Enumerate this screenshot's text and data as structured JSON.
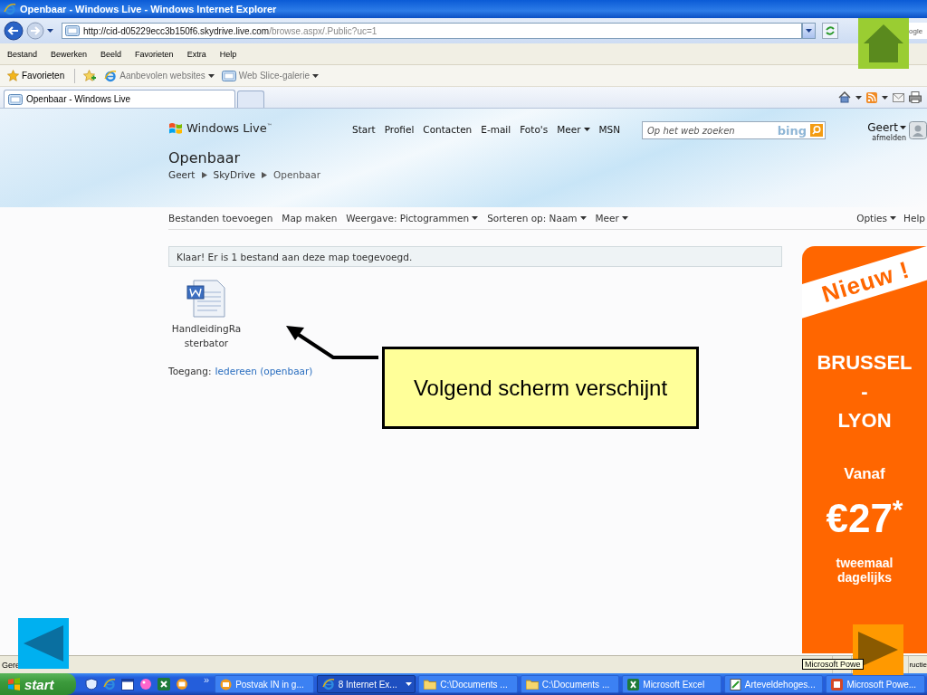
{
  "window": {
    "title": "Openbaar - Windows Live - Windows Internet Explorer"
  },
  "address_bar": {
    "url_host": "http://cid-d05229ecc3b150f6.skydrive.live.com",
    "url_path": "/browse.aspx/.Public?uc=1",
    "search_placeholder": "ogle"
  },
  "menu": [
    "Bestand",
    "Bewerken",
    "Beeld",
    "Favorieten",
    "Extra",
    "Help"
  ],
  "favorites_bar": {
    "favorites": "Favorieten",
    "links": [
      {
        "label": "Aanbevolen websites",
        "dropdown": true
      },
      {
        "label": "Web Slice-galerie",
        "dropdown": true
      }
    ]
  },
  "tabs": [
    {
      "label": "Openbaar - Windows Live",
      "selected": true
    }
  ],
  "page": {
    "logo": "Windows Live$^{™}$",
    "nav": [
      {
        "label": "Start",
        "dropdown": false
      },
      {
        "label": "Profiel",
        "dropdown": false
      },
      {
        "label": "Contacten",
        "dropdown": false
      },
      {
        "label": "E-mail",
        "dropdown": false
      },
      {
        "label": "Foto's",
        "dropdown": false
      },
      {
        "label": "Meer",
        "dropdown": true
      },
      {
        "label": "MSN",
        "dropdown": false
      }
    ],
    "search_placeholder": "Op het web zoeken",
    "search_brand": "bing",
    "user": "Geert",
    "user_dropdown": true,
    "signout": "afmelden",
    "title": "Openbaar",
    "breadcrumb": [
      "Geert",
      "SkyDrive",
      "Openbaar"
    ],
    "toolbar": [
      {
        "label": "Bestanden toevoegen",
        "dropdown": false
      },
      {
        "label": "Map maken",
        "dropdown": false
      },
      {
        "label": "Weergave: Pictogrammen",
        "dropdown": true
      },
      {
        "label": "Sorteren op: Naam",
        "dropdown": true
      },
      {
        "label": "Meer",
        "dropdown": true
      }
    ],
    "toolbar_right": [
      {
        "label": "Opties",
        "dropdown": true
      },
      {
        "label": "Help",
        "dropdown": false
      }
    ],
    "message": "Klaar! Er is 1 bestand aan deze map toegevoegd.",
    "files": [
      {
        "name": "HandleidingRasterbator"
      }
    ],
    "access_label": "Toegang:",
    "access_link": "Iedereen (openbaar)"
  },
  "ad": {
    "banner": "Nieuw !",
    "route": [
      "BRUSSEL",
      "-",
      "LYON"
    ],
    "from": "Vanaf",
    "price": "€27",
    "price_mark": "*",
    "frequency": "tweemaal dagelijks"
  },
  "callout": {
    "text": "Volgend scherm verschijnt"
  },
  "status_bar": {
    "text": "Gere",
    "tooltip": "Microsoft Powe",
    "text_right": "ructie"
  },
  "taskbar": {
    "start": "start",
    "overflow": "»",
    "buttons": [
      {
        "label": "Postvak IN in g...",
        "selected": false,
        "dropdown": false
      },
      {
        "label": "8 Internet Ex...",
        "selected": true,
        "dropdown": true
      },
      {
        "label": "C:\\Documents ...",
        "selected": false,
        "dropdown": false
      },
      {
        "label": "C:\\Documents ...",
        "selected": false,
        "dropdown": false
      },
      {
        "label": "Microsoft Excel",
        "selected": false,
        "dropdown": false
      },
      {
        "label": "Arteveldehoges...",
        "selected": false,
        "dropdown": false
      },
      {
        "label": "Microsoft Powe...",
        "selected": false,
        "dropdown": false
      }
    ]
  }
}
